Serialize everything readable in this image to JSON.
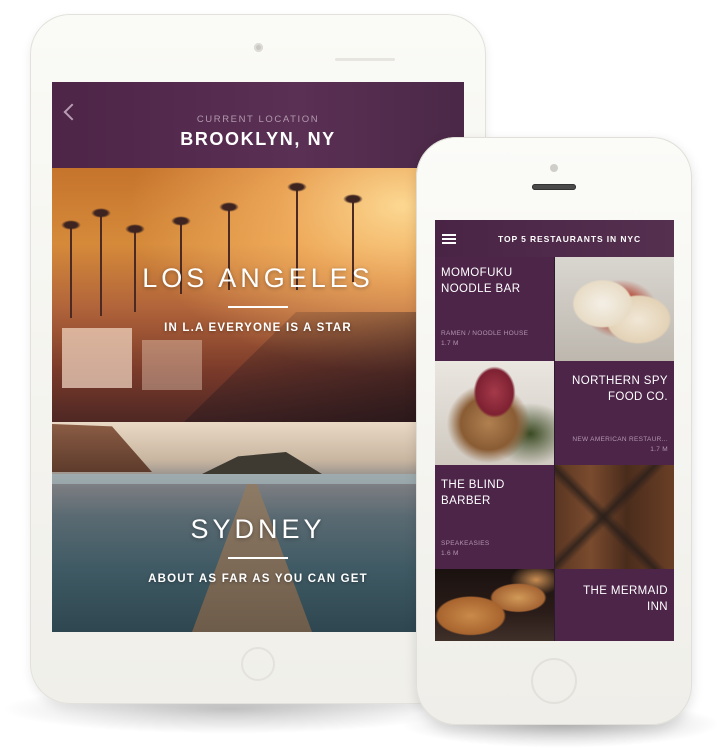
{
  "tablet": {
    "header": {
      "back_icon": "chevron-left-icon",
      "subtitle": "CURRENT LOCATION",
      "title": "BROOKLYN, NY"
    },
    "cities": [
      {
        "name": "LOS ANGELES",
        "tagline": "IN L.A EVERYONE IS A STAR"
      },
      {
        "name": "SYDNEY",
        "tagline": "ABOUT AS FAR AS YOU CAN GET"
      }
    ]
  },
  "phone": {
    "header": {
      "menu_icon": "hamburger-menu-icon",
      "title": "TOP 5 RESTAURANTS IN NYC"
    },
    "restaurants": [
      {
        "name_line1": "MOMOFUKU",
        "name_line2": "NOODLE BAR",
        "category": "RAMEN /  NOODLE HOUSE",
        "distance": "1.7 M"
      },
      {
        "name_line1": "NORTHERN SPY",
        "name_line2": "FOOD CO.",
        "category": "NEW AMERICAN RESTAUR...",
        "distance": "1.7 M"
      },
      {
        "name_line1": "THE BLIND",
        "name_line2": "BARBER",
        "category": "SPEAKEASIES",
        "distance": "1.6 M"
      },
      {
        "name_line1": "THE MERMAID",
        "name_line2": "INN",
        "category": "",
        "distance": ""
      }
    ]
  },
  "colors": {
    "brand_purple": "#4c2549",
    "header_purple": "#55304f",
    "muted_text": "#b495ad"
  }
}
